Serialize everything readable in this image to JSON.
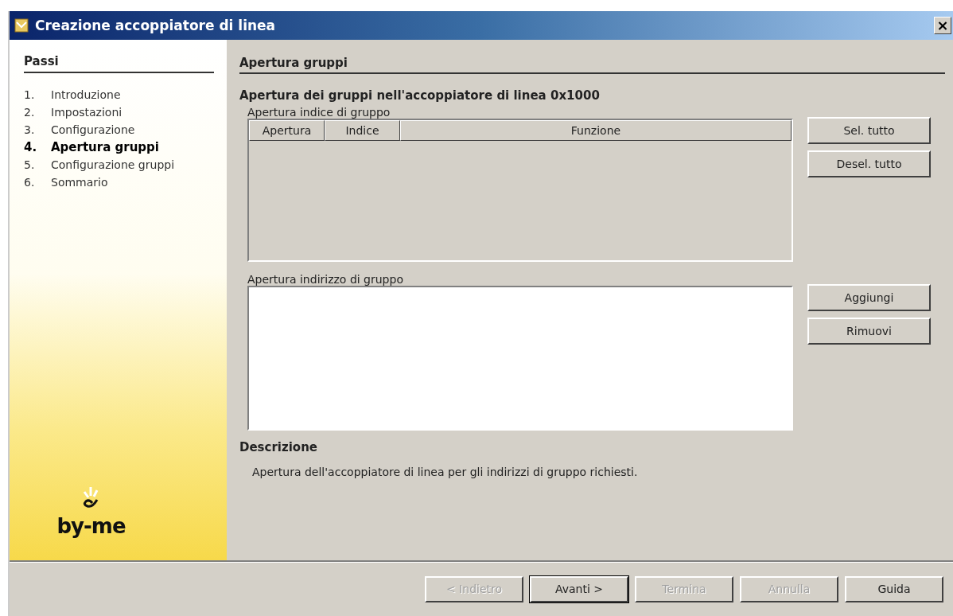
{
  "window": {
    "title": "Creazione accoppiatore di linea",
    "close": "×"
  },
  "sidebar": {
    "heading": "Passi",
    "steps": [
      {
        "number": "1.",
        "label": "Introduzione",
        "selected": false
      },
      {
        "number": "2.",
        "label": "Impostazioni",
        "selected": false
      },
      {
        "number": "3.",
        "label": "Configurazione",
        "selected": false
      },
      {
        "number": "4.",
        "label": "Apertura gruppi",
        "selected": true
      },
      {
        "number": "5.",
        "label": "Configurazione gruppi",
        "selected": false
      },
      {
        "number": "6.",
        "label": "Sommario",
        "selected": false
      }
    ],
    "logo": "by-me"
  },
  "page": {
    "heading": "Apertura gruppi",
    "subtitle": "Apertura dei gruppi nell'accoppiatore di linea 0x1000",
    "index_group": {
      "label": "Apertura indice di gruppo",
      "columns": [
        "Apertura",
        "Indice",
        "Funzione"
      ],
      "buttons": [
        "Sel. tutto",
        "Desel. tutto"
      ]
    },
    "address_group": {
      "label": "Apertura indirizzo di gruppo",
      "buttons": [
        "Aggiungi",
        "Rimuovi"
      ]
    },
    "description": {
      "heading": "Descrizione",
      "text": "Apertura dell'accoppiatore di linea per gli indirizzi di gruppo richiesti."
    }
  },
  "footer": {
    "buttons": [
      {
        "label": "< Indietro",
        "disabled": true,
        "default": false
      },
      {
        "label": "Avanti >",
        "disabled": false,
        "default": true
      },
      {
        "label": "Termina",
        "disabled": true,
        "default": false
      },
      {
        "label": "Annulla",
        "disabled": true,
        "default": false
      },
      {
        "label": "Guida",
        "disabled": false,
        "default": false
      }
    ]
  }
}
